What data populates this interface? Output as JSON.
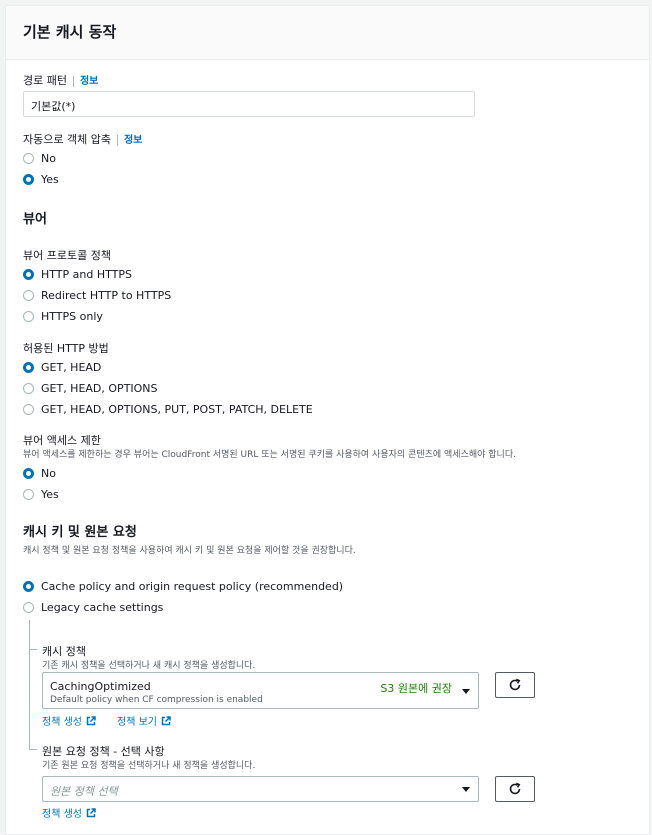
{
  "section_title": "기본 캐시 동작",
  "path": {
    "label": "경로 패턴",
    "info": "정보",
    "value": "기본값(*)"
  },
  "compress": {
    "label": "자동으로 객체 압축",
    "info": "정보",
    "options": [
      "No",
      "Yes"
    ],
    "selected": "Yes"
  },
  "viewer": {
    "heading": "뷰어",
    "protocol": {
      "label": "뷰어 프로토콜 정책",
      "options": [
        "HTTP and HTTPS",
        "Redirect HTTP to HTTPS",
        "HTTPS only"
      ],
      "selected": "HTTP and HTTPS"
    },
    "methods": {
      "label": "허용된 HTTP 방법",
      "options": [
        "GET, HEAD",
        "GET, HEAD, OPTIONS",
        "GET, HEAD, OPTIONS, PUT, POST, PATCH, DELETE"
      ],
      "selected": "GET, HEAD"
    },
    "restrict": {
      "label": "뷰어 액세스 제한",
      "description": "뷰어 액세스를 제한하는 경우 뷰어는 CloudFront 서명된 URL 또는 서명된 쿠키를 사용하여 사용자의 콘텐츠에 액세스해야 합니다.",
      "options": [
        "No",
        "Yes"
      ],
      "selected": "No"
    }
  },
  "cache": {
    "heading": "캐시 키 및 원본 요청",
    "description": "캐시 정책 및 원본 요청 정책을 사용하여 캐시 키 및 원본 요청을 제어할 것을 권장합니다.",
    "options": [
      "Cache policy and origin request policy (recommended)",
      "Legacy cache settings"
    ],
    "selected": "Cache policy and origin request policy (recommended)",
    "cache_policy": {
      "label": "캐시 정책",
      "description": "기존 캐시 정책을 선택하거나 새 캐시 정책을 생성합니다.",
      "selected_name": "CachingOptimized",
      "selected_desc": "Default policy when CF compression is enabled",
      "badge": "S3 원본에 권장",
      "create_link": "정책 생성",
      "view_link": "정책 보기"
    },
    "origin_policy": {
      "label": "원본 요청 정책 - 선택 사항",
      "description": "기존 원본 요청 정책을 선택하거나 새 정책을 생성합니다.",
      "placeholder": "원본 정책 선택",
      "create_link": "정책 생성"
    }
  },
  "colors": {
    "accent": "#0073bb",
    "badge": "#1d8102"
  }
}
